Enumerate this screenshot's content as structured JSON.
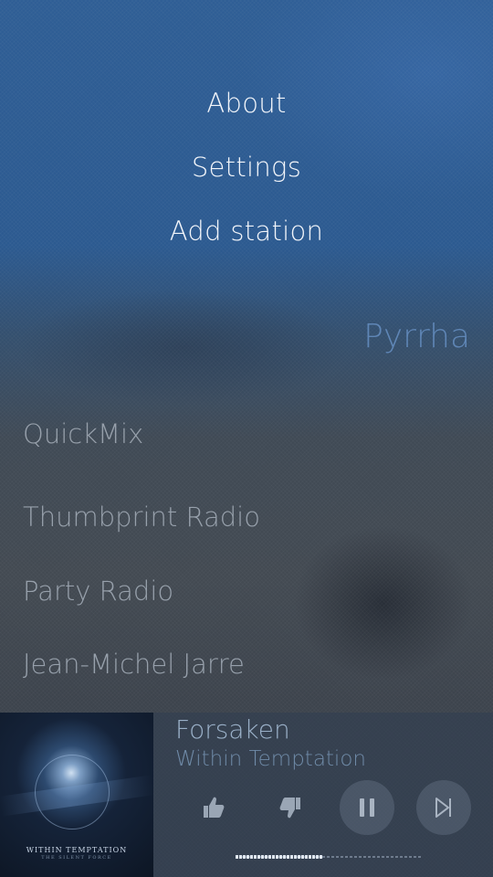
{
  "pulley_menu": {
    "items": [
      "About",
      "Settings",
      "Add station"
    ]
  },
  "header": {
    "title": "Pyrrha"
  },
  "stations": [
    "QuickMix",
    "Thumbprint Radio",
    "Party Radio",
    "Jean-Michel Jarre"
  ],
  "player": {
    "cover": {
      "band_text": "WITHIN TEMPTATION",
      "album_text": "THE SILENT FORCE"
    },
    "track_title": "Forsaken",
    "artist": "Within Temptation",
    "progress": 0.47,
    "controls": {
      "thumb_up_icon": "thumbs-up-icon",
      "thumb_down_icon": "thumbs-down-icon",
      "pause_icon": "pause-icon",
      "next_icon": "skip-next-icon"
    }
  },
  "colors": {
    "menu_text": "#f2f5fa",
    "title_accent": "#5f86b6",
    "station_text": "#97a0ab"
  }
}
